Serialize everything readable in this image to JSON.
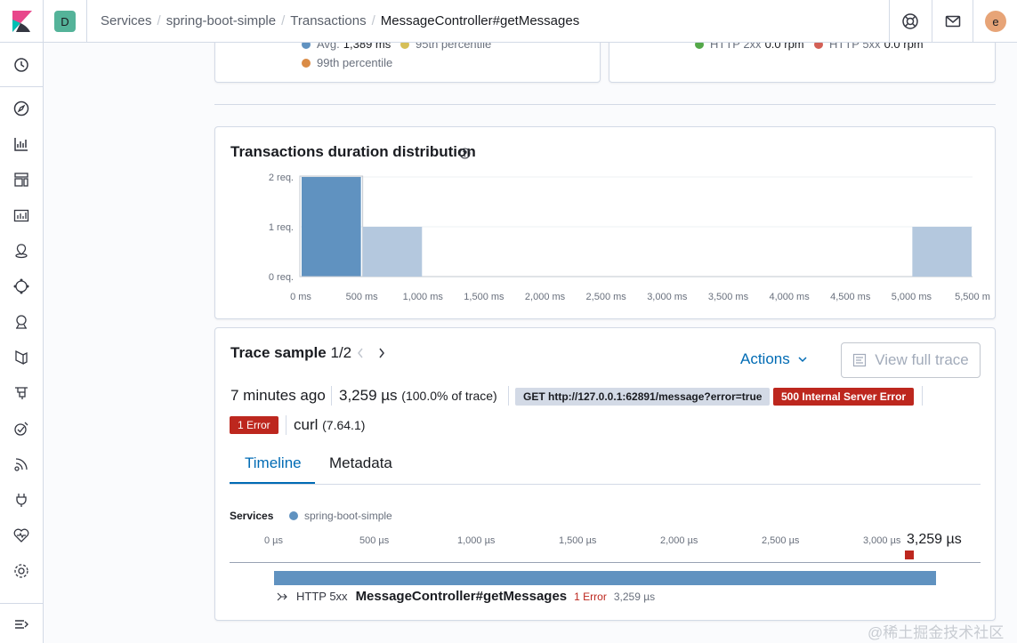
{
  "breadcrumbs": [
    "Services",
    "spring-boot-simple",
    "Transactions",
    "MessageController#getMessages"
  ],
  "space_initial": "D",
  "avatar_initial": "e",
  "sidebar_icons": [
    "recently-viewed-icon",
    "discover-icon",
    "visualize-icon",
    "dashboard-icon",
    "canvas-icon",
    "maps-icon",
    "ml-icon",
    "metrics-icon",
    "logs-icon",
    "apm-icon",
    "uptime-icon",
    "siem-icon",
    "dev-tools-icon",
    "stack-monitoring-icon",
    "management-icon",
    "collapse-nav-icon"
  ],
  "upper_panels": {
    "left_legend": [
      {
        "label": "Avg.",
        "value": "1,389 ms",
        "color": "#6092c0"
      },
      {
        "label": "95th percentile",
        "value": "",
        "color": "#d6bf57"
      },
      {
        "label": "99th percentile",
        "value": "",
        "color": "#da8b45"
      }
    ],
    "right_legend": [
      {
        "label": "HTTP 2xx",
        "value": "0.0 rpm",
        "color": "#54a849"
      },
      {
        "label": "HTTP 5xx",
        "value": "0.0 rpm",
        "color": "#d36056"
      }
    ]
  },
  "distribution": {
    "title": "Transactions duration distribution",
    "help_icon": "question-circle-icon"
  },
  "chart_data": {
    "type": "bar",
    "title": "Transactions duration distribution",
    "x_unit": "ms",
    "x_ticks": [
      "0 ms",
      "500 ms",
      "1,000 ms",
      "1,500 ms",
      "2,000 ms",
      "2,500 ms",
      "3,000 ms",
      "3,500 ms",
      "4,000 ms",
      "4,500 ms",
      "5,000 ms",
      "5,500 m"
    ],
    "y_ticks": [
      "0 req.",
      "1 req.",
      "2 req."
    ],
    "ylim": [
      0,
      2
    ],
    "xlim": [
      0,
      5500
    ],
    "bin_width": 500,
    "bins": [
      {
        "x0": 0,
        "x1": 500,
        "value": 2,
        "selected": true
      },
      {
        "x0": 500,
        "x1": 1000,
        "value": 1,
        "selected": false
      },
      {
        "x0": 5000,
        "x1": 5500,
        "value": 1,
        "selected": false
      }
    ],
    "colors": {
      "selected": "#6092c0",
      "other": "#b4c8de"
    }
  },
  "trace": {
    "title": "Trace sample",
    "position": "1/2",
    "actions_label": "Actions",
    "view_full_trace": "View full trace",
    "time_ago": "7 minutes ago",
    "duration": "3,259 µs",
    "percent": "(100.0% of trace)",
    "request": "GET http://127.0.0.1:62891/message?error=true",
    "status": "500 Internal Server Error",
    "errors_badge": "1 Error",
    "user_agent": "curl",
    "user_agent_version": "(7.64.1)"
  },
  "tabs": [
    {
      "label": "Timeline",
      "active": true
    },
    {
      "label": "Metadata",
      "active": false
    }
  ],
  "timeline": {
    "services_label": "Services",
    "service_name": "spring-boot-simple",
    "service_color": "#6092c0",
    "axis_ticks": [
      "0 µs",
      "500 µs",
      "1,000 µs",
      "1,500 µs",
      "2,000 µs",
      "2,500 µs",
      "3,000 µs"
    ],
    "total_duration": "3,259 µs",
    "error_marker_color": "#bd271e",
    "span": {
      "type": "HTTP 5xx",
      "name": "MessageController#getMessages",
      "errors": "1 Error",
      "duration": "3,259 µs"
    }
  },
  "watermark": "@稀土掘金技术社区"
}
